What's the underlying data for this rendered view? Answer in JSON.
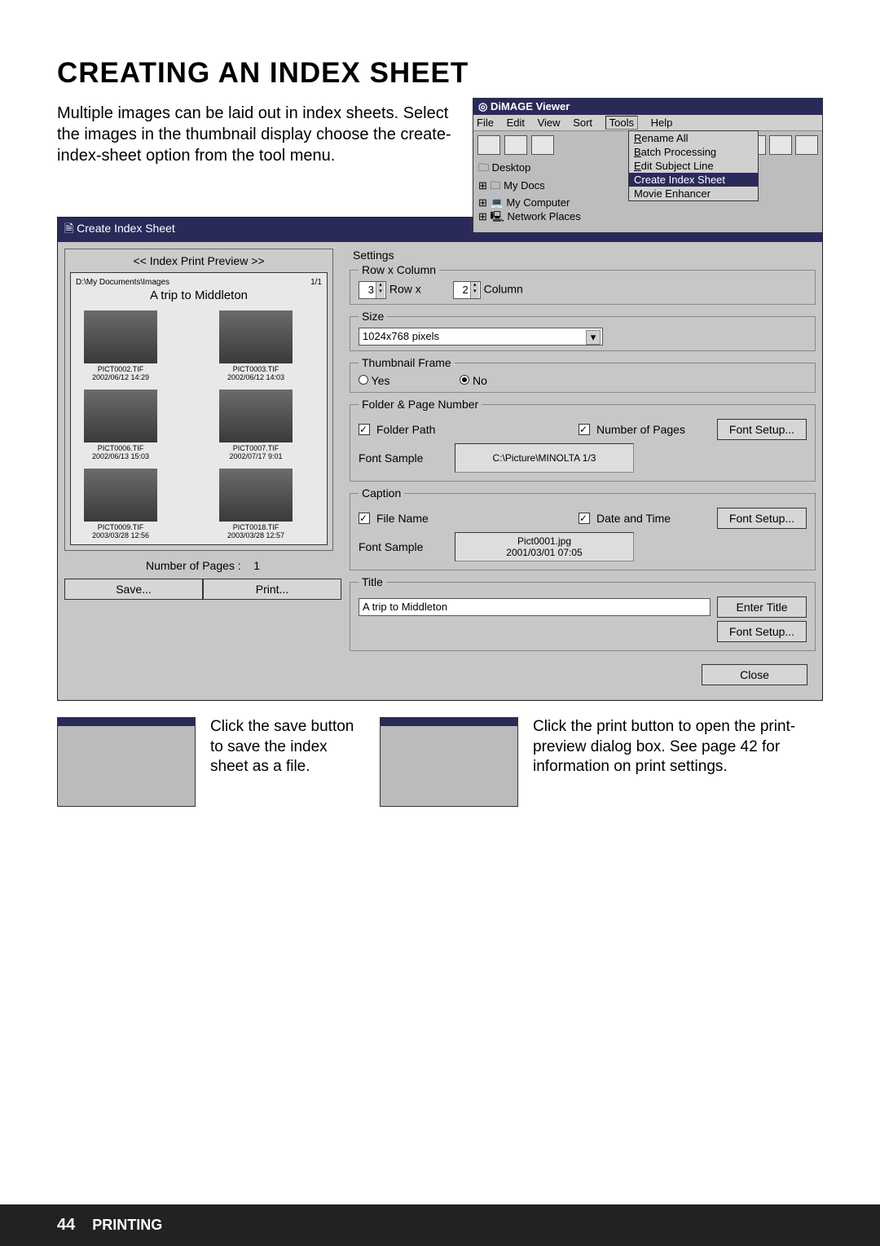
{
  "page": {
    "title": "CREATING AN INDEX SHEET",
    "intro": "Multiple images can be laid out in index sheets. Select the images in the thumbnail display choose the create-index-sheet option from the tool menu.",
    "footer_page": "44",
    "footer_section": "PRINTING"
  },
  "viewer": {
    "title": "DiMAGE Viewer",
    "menu": {
      "file": "File",
      "edit": "Edit",
      "view": "View",
      "sort": "Sort",
      "tools": "Tools",
      "help": "Help"
    },
    "tools_menu": {
      "rename": "Rename All",
      "batch": "Batch Processing",
      "edit_subject": "Edit Subject Line",
      "create_index": "Create Index Sheet",
      "movie": "Movie Enhancer"
    },
    "tree": {
      "desktop": "Desktop",
      "mydocs": "My Docs",
      "mycomputer": "My Computer",
      "network": "Network Places"
    }
  },
  "cis": {
    "title": "Create Index Sheet",
    "preview_label": "<< Index Print Preview >>",
    "path": "D:\\My Documents\\Images",
    "page_indicator": "1/1",
    "sheet_title": "A trip to Middleton",
    "thumbs": [
      {
        "name": "PICT0002.TIF",
        "date": "2002/06/12 14:29"
      },
      {
        "name": "PICT0003.TIF",
        "date": "2002/06/12 14:03"
      },
      {
        "name": "PICT0006.TIF",
        "date": "2002/06/13 15:03"
      },
      {
        "name": "PICT0007.TIF",
        "date": "2002/07/17  9:01"
      },
      {
        "name": "PICT0009.TIF",
        "date": "2003/03/28 12:56"
      },
      {
        "name": "PICT0018.TIF",
        "date": "2003/03/28 12:57"
      }
    ],
    "num_pages_label": "Number of Pages :",
    "num_pages_value": "1",
    "save_btn": "Save...",
    "print_btn": "Print...",
    "close_btn": "Close",
    "settings_hdr": "Settings",
    "rowcol": {
      "legend": "Row x Column",
      "row_val": "3",
      "row_lbl": "Row  x",
      "col_val": "2",
      "col_lbl": "Column"
    },
    "size": {
      "legend": "Size",
      "value": "1024x768 pixels"
    },
    "frame": {
      "legend": "Thumbnail Frame",
      "yes": "Yes",
      "no": "No"
    },
    "folder": {
      "legend": "Folder & Page Number",
      "folder_path": "Folder Path",
      "num_pages": "Number of Pages",
      "font_setup": "Font Setup...",
      "sample_lbl": "Font Sample",
      "sample_val": "C:\\Picture\\MINOLTA  1/3"
    },
    "caption": {
      "legend": "Caption",
      "filename": "File Name",
      "datetime": "Date and Time",
      "font_setup": "Font Setup...",
      "sample_lbl": "Font Sample",
      "sample_line1": "Pict0001.jpg",
      "sample_line2": "2001/03/01 07:05"
    },
    "title_group": {
      "legend": "Title",
      "value": "A trip to Middleton",
      "enter": "Enter Title",
      "font_setup": "Font Setup..."
    }
  },
  "callouts": {
    "save": "Click the save button to save the index sheet as a file.",
    "print": "Click the print button to open the print-preview dialog box. See page 42 for information on print settings."
  }
}
